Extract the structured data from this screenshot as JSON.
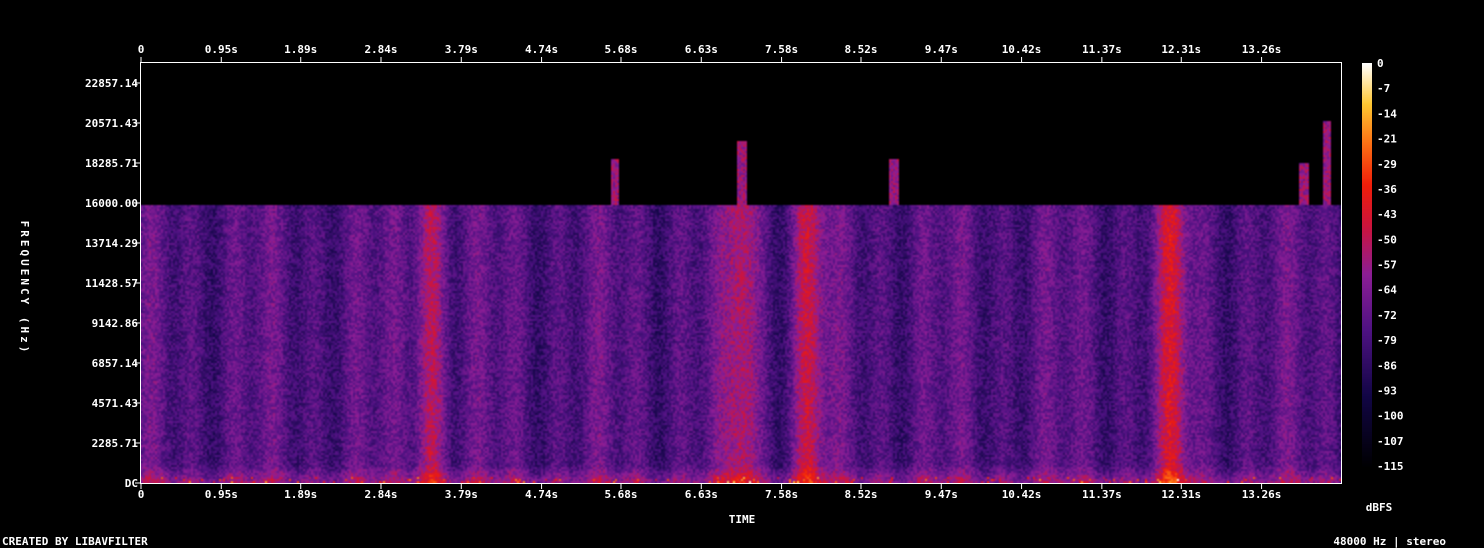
{
  "chart_data": {
    "type": "heatmap",
    "title": "",
    "xlabel": "TIME",
    "ylabel": "FREQUENCY (Hz)",
    "x_ticks": [
      "0",
      "0.95s",
      "1.89s",
      "2.84s",
      "3.79s",
      "4.74s",
      "5.68s",
      "6.63s",
      "7.58s",
      "8.52s",
      "9.47s",
      "10.42s",
      "11.37s",
      "12.31s",
      "13.26s"
    ],
    "x_tick_values": [
      0,
      0.95,
      1.89,
      2.84,
      3.79,
      4.74,
      5.68,
      6.63,
      7.58,
      8.52,
      9.47,
      10.42,
      11.37,
      12.31,
      13.26
    ],
    "xlim": [
      0,
      14.2
    ],
    "y_ticks": [
      "DC",
      "2285.71",
      "4571.43",
      "6857.14",
      "9142.86",
      "11428.57",
      "13714.29",
      "16000.00",
      "18285.71",
      "20571.43",
      "22857.14"
    ],
    "y_tick_values": [
      0,
      2285.71,
      4571.43,
      6857.14,
      9142.86,
      11428.57,
      13714.29,
      16000.0,
      18285.71,
      20571.43,
      22857.14
    ],
    "ylim": [
      0,
      24000
    ],
    "colorbar": {
      "label": "dBFS",
      "ticks": [
        "0",
        "-7",
        "-14",
        "-21",
        "-29",
        "-36",
        "-43",
        "-50",
        "-57",
        "-64",
        "-72",
        "-79",
        "-86",
        "-93",
        "-100",
        "-107",
        "-115"
      ],
      "range": [
        -120,
        0
      ]
    },
    "energy_cutoff_hz": 16000,
    "loud_bursts_s": [
      3.4,
      7.1,
      7.9,
      12.2
    ],
    "high_spikes": [
      {
        "t": 5.6,
        "f_top": 18600
      },
      {
        "t": 7.1,
        "f_top": 19600
      },
      {
        "t": 8.9,
        "f_top": 18600
      },
      {
        "t": 13.75,
        "f_top": 18300
      },
      {
        "t": 14.03,
        "f_top": 20800
      }
    ],
    "grid": false,
    "legend": "none"
  },
  "footer": {
    "left": "CREATED BY LIBAVFILTER",
    "right": "48000 Hz | stereo"
  }
}
